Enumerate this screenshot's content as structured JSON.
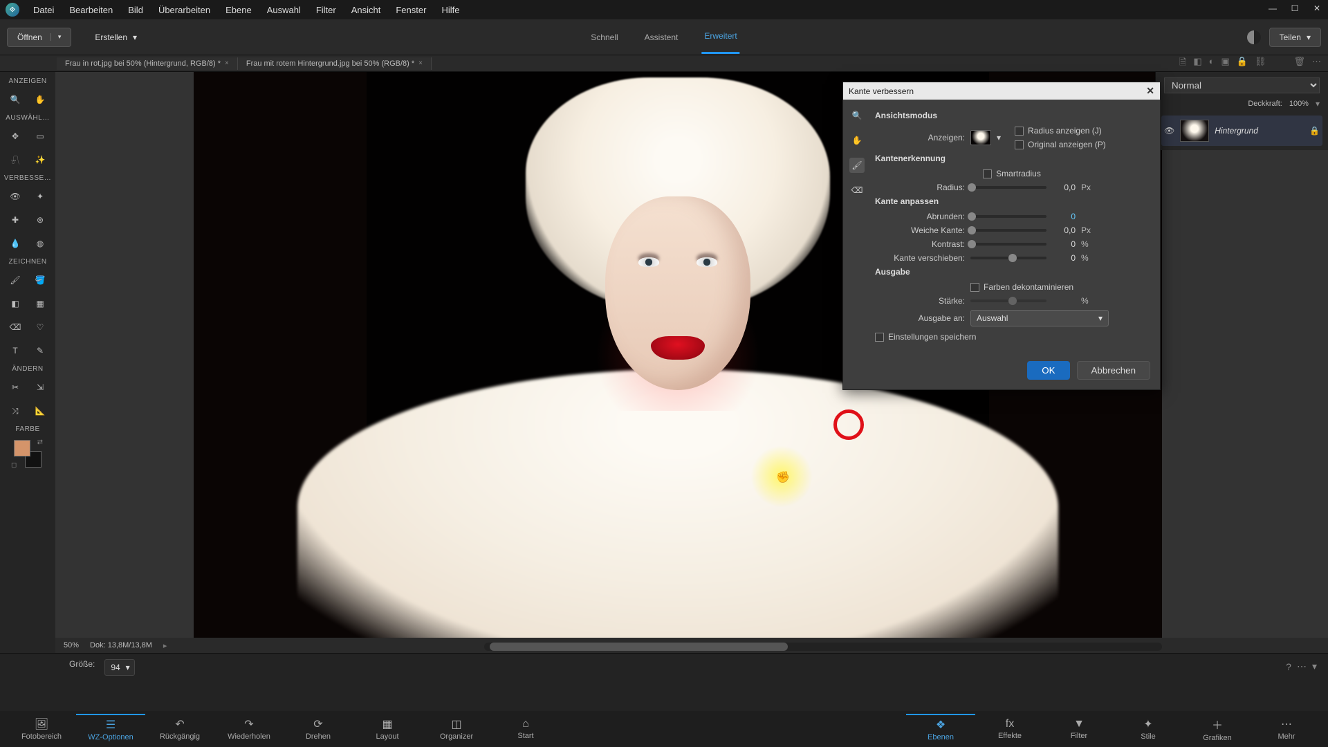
{
  "menu": {
    "items": [
      "Datei",
      "Bearbeiten",
      "Bild",
      "Überarbeiten",
      "Ebene",
      "Auswahl",
      "Filter",
      "Ansicht",
      "Fenster",
      "Hilfe"
    ]
  },
  "topbar": {
    "open": "Öffnen",
    "create": "Erstellen",
    "modes": [
      "Schnell",
      "Assistent",
      "Erweitert"
    ],
    "active_mode": 2,
    "share": "Teilen"
  },
  "tabs": [
    {
      "label": "Frau in rot.jpg bei 50% (Hintergrund, RGB/8) *"
    },
    {
      "label": "Frau mit rotem Hintergrund.jpg bei 50% (RGB/8) *"
    }
  ],
  "tool_sections": {
    "anzeigen": "ANZEIGEN",
    "auswahl": "AUSWÄHL…",
    "verbessern": "VERBESSE…",
    "zeichnen": "ZEICHNEN",
    "aendern": "ÄNDERN",
    "farbe": "FARBE"
  },
  "canvas_status": {
    "zoom": "50%",
    "doc": "Dok: 13,8M/13,8M"
  },
  "tool_options": {
    "size_label": "Größe:",
    "size_value": "94"
  },
  "bottombar": {
    "left": [
      "Fotobereich",
      "WZ-Optionen",
      "Rückgängig",
      "Wiederholen",
      "Drehen",
      "Layout",
      "Organizer",
      "Start"
    ],
    "left_active": 1,
    "right": [
      "Ebenen",
      "Effekte",
      "Filter",
      "Stile",
      "Grafiken",
      "Mehr"
    ],
    "right_active": 0
  },
  "layers": {
    "blend_mode": "Normal",
    "opacity_label": "Deckkraft:",
    "opacity_value": "100%",
    "layer_name": "Hintergrund"
  },
  "dialog": {
    "title": "Kante verbessern",
    "section_view": "Ansichtsmodus",
    "view_label": "Anzeigen:",
    "show_radius": "Radius anzeigen (J)",
    "show_original": "Original anzeigen (P)",
    "section_edge": "Kantenerkennung",
    "smart_radius": "Smartradius",
    "radius_label": "Radius:",
    "radius_value": "0,0",
    "px": "Px",
    "section_adjust": "Kante anpassen",
    "smooth_label": "Abrunden:",
    "smooth_value": "0",
    "feather_label": "Weiche Kante:",
    "feather_value": "0,0",
    "contrast_label": "Kontrast:",
    "contrast_value": "0",
    "shift_label": "Kante verschieben:",
    "shift_value": "0",
    "pct": "%",
    "section_output": "Ausgabe",
    "decontaminate": "Farben dekontaminieren",
    "amount_label": "Stärke:",
    "output_to_label": "Ausgabe an:",
    "output_to_value": "Auswahl",
    "remember": "Einstellungen speichern",
    "ok": "OK",
    "cancel": "Abbrechen"
  }
}
